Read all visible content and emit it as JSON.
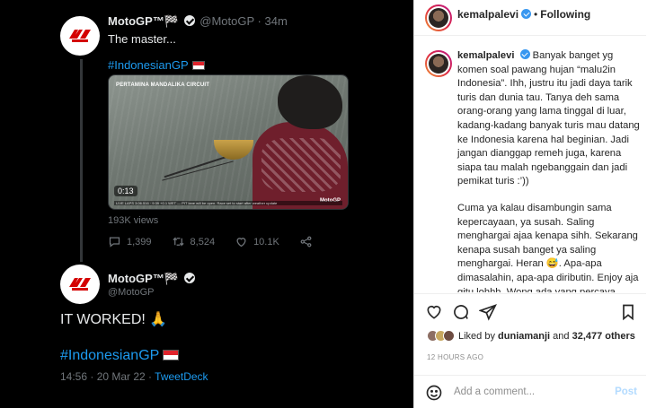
{
  "tweet1": {
    "author_name": "MotoGP™🏁",
    "author_handle": "@MotoGP",
    "time": "· 34m",
    "text": "The master...",
    "hashtag": "#IndonesianGP",
    "video": {
      "overlay_title": "PERTAMINA MANDALIKA CIRCUIT",
      "duration": "0:13",
      "brand": "MotoGP",
      "ticker": "LIVE LAPS 3:06.516 · 9:39 +0.1 WET — PIT lane will be open. Race set to start after weather update"
    },
    "views": "193K views",
    "replies": "1,399",
    "retweets": "8,524",
    "likes": "10.1K"
  },
  "tweet2": {
    "author_name": "MotoGP™🏁",
    "author_handle": "@MotoGP",
    "text": "IT WORKED! 🙏",
    "hashtag": "#IndonesianGP",
    "timestamp": "14:56 · 20 Mar 22 · ",
    "source": "TweetDeck"
  },
  "instagram": {
    "username": "kemalpalevi",
    "dot": "•",
    "follow_status": "Following",
    "caption_user": "kemalpalevi",
    "caption_p1": "Banyak banget yg komen soal pawang hujan “malu2in Indonesia”. Ihh, justru itu jadi daya tarik turis dan dunia tau. Tanya deh sama orang-orang yang lama tinggal di luar, kadang-kadang banyak turis mau datang ke Indonesia karena hal beginian. Jadi jangan dianggap remeh juga, karena siapa tau malah ngebanggain dan jadi pemikat turis :’))",
    "caption_p2": "Cuma ya kalau disambungin sama kepercayaan, ya susah. Saling menghargai ajaa kenapa sihh. Sekarang kenapa susah banget ya saling menghargai. Heran 😅. Apa-apa dimasalahin, apa-apa diributin. Enjoy aja gitu lohhh. Wong ada yang percaya zodiak juga gak pernah ada yang",
    "liked_by_prefix": "Liked by",
    "liked_by_user": "duniamanji",
    "liked_by_and": "and",
    "liked_by_count": "32,477 others",
    "time_ago": "12 HOURS AGO",
    "comment_placeholder": "Add a comment...",
    "post_label": "Post"
  },
  "colors": {
    "twitter_bg": "#000000",
    "twitter_link": "#1d9bf0",
    "twitter_muted": "#71767b",
    "ig_verified": "#3897f0",
    "ig_post_disabled": "#b3dbff"
  },
  "icons": [
    "motogp-logo-icon",
    "verified-badge-icon",
    "reply-icon",
    "retweet-icon",
    "like-icon",
    "share-icon",
    "heart-icon",
    "comment-icon",
    "send-icon",
    "bookmark-icon",
    "emoji-icon",
    "flag-indonesia-icon"
  ]
}
